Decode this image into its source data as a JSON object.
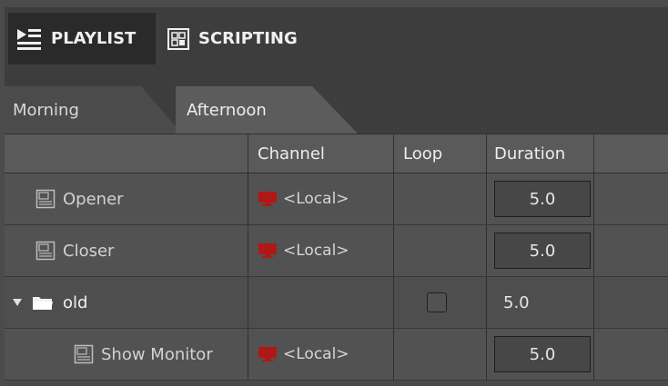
{
  "toolbar": {
    "playlist_label": "PLAYLIST",
    "scripting_label": "SCRIPTING",
    "playlist_icon": "playlist-icon",
    "scripting_icon": "scripting-icon"
  },
  "tabs": [
    {
      "label": "Morning",
      "active": false
    },
    {
      "label": "Afternoon",
      "active": true
    }
  ],
  "table": {
    "columns": [
      "",
      "Channel",
      "Loop",
      "Duration",
      ""
    ],
    "rows": [
      {
        "name": "Opener",
        "icon": "scene-icon",
        "channel": "<Local>",
        "channel_icon": "monitor-icon",
        "loop": false,
        "duration": "5.0"
      },
      {
        "name": "Closer",
        "icon": "scene-icon",
        "channel": "<Local>",
        "channel_icon": "monitor-icon",
        "loop": false,
        "duration": "5.0"
      },
      {
        "name": "old",
        "icon": "folder-icon",
        "expanded": true,
        "channel": "",
        "loop": false,
        "duration": "5.0"
      },
      {
        "name": "Show Monitor",
        "icon": "scene-icon",
        "channel": "<Local>",
        "channel_icon": "monitor-icon",
        "loop": false,
        "duration": "5.0"
      }
    ]
  },
  "colors": {
    "monitor_red": "#b01818",
    "background": "#444444",
    "header": "#5a5a5a"
  }
}
